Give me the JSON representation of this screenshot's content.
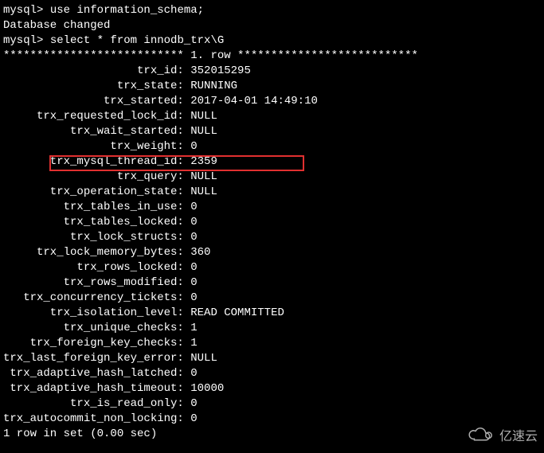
{
  "prompt1": "mysql> ",
  "cmd1": "use information_schema;",
  "dbchanged": "Database changed",
  "prompt2": "mysql> ",
  "cmd2": "select * from innodb_trx\\G",
  "row_separator": "*************************** 1. row ***************************",
  "fields": {
    "trx_id": "352015295",
    "trx_state": "RUNNING",
    "trx_started": "2017-04-01 14:49:10",
    "trx_requested_lock_id": "NULL",
    "trx_wait_started": "NULL",
    "trx_weight": "0",
    "trx_mysql_thread_id": "2359",
    "trx_query": "NULL",
    "trx_operation_state": "NULL",
    "trx_tables_in_use": "0",
    "trx_tables_locked": "0",
    "trx_lock_structs": "0",
    "trx_lock_memory_bytes": "360",
    "trx_rows_locked": "0",
    "trx_rows_modified": "0",
    "trx_concurrency_tickets": "0",
    "trx_isolation_level": "READ COMMITTED",
    "trx_unique_checks": "1",
    "trx_foreign_key_checks": "1",
    "trx_last_foreign_key_error": "NULL",
    "trx_adaptive_hash_latched": "0",
    "trx_adaptive_hash_timeout": "10000",
    "trx_is_read_only": "0",
    "trx_autocommit_non_locking": "0"
  },
  "field_order": [
    "trx_id",
    "trx_state",
    "trx_started",
    "trx_requested_lock_id",
    "trx_wait_started",
    "trx_weight",
    "trx_mysql_thread_id",
    "trx_query",
    "trx_operation_state",
    "trx_tables_in_use",
    "trx_tables_locked",
    "trx_lock_structs",
    "trx_lock_memory_bytes",
    "trx_rows_locked",
    "trx_rows_modified",
    "trx_concurrency_tickets",
    "trx_isolation_level",
    "trx_unique_checks",
    "trx_foreign_key_checks",
    "trx_last_foreign_key_error",
    "trx_adaptive_hash_latched",
    "trx_adaptive_hash_timeout",
    "trx_is_read_only",
    "trx_autocommit_non_locking"
  ],
  "label_width": 26,
  "highlight_field": "trx_mysql_thread_id",
  "footer": "1 row in set (0.00 sec)",
  "watermark_text": "亿速云"
}
